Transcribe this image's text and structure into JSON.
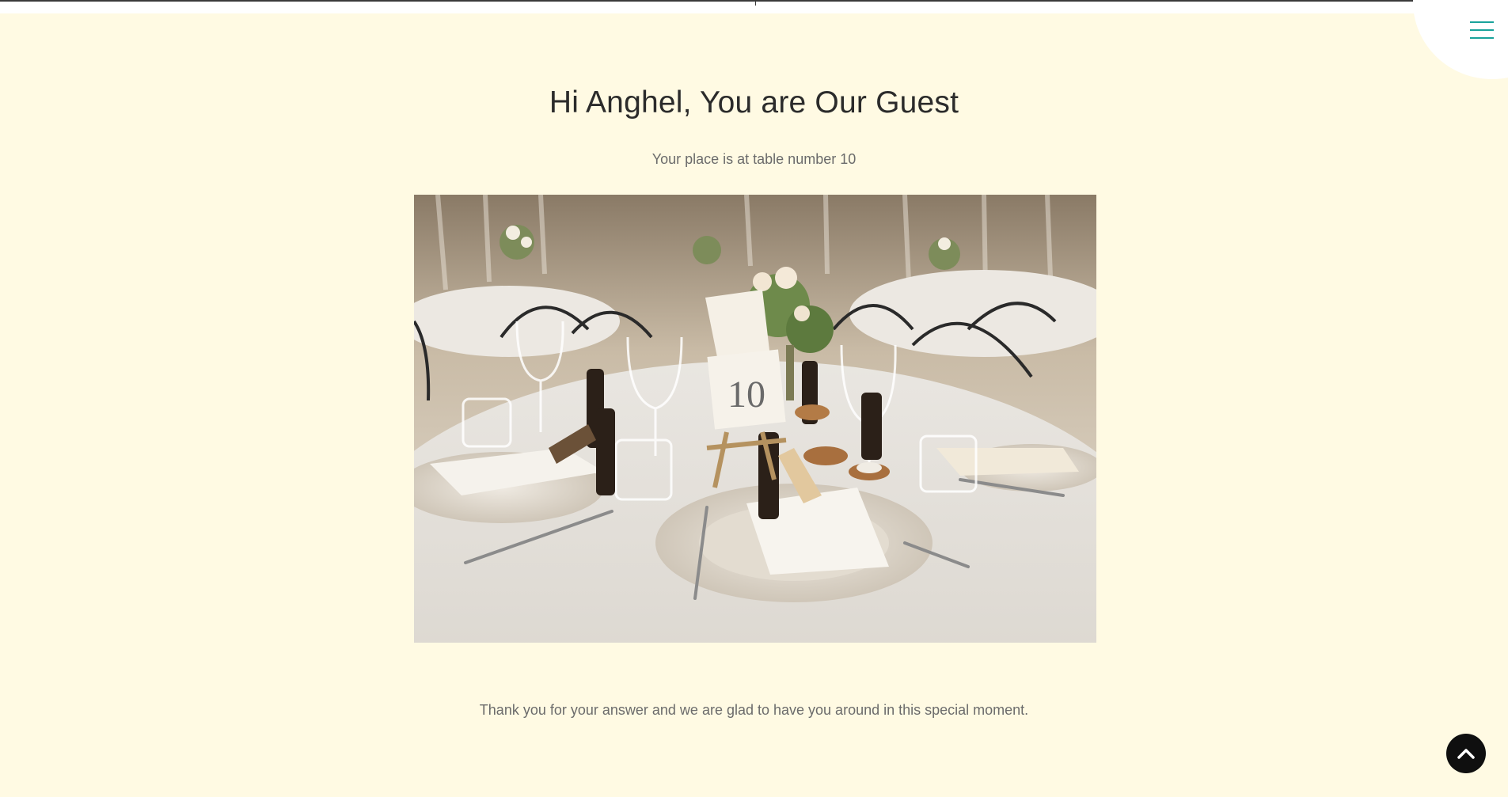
{
  "header": {
    "menu_icon": "hamburger-menu-icon",
    "accent_color": "#1aa39b"
  },
  "main": {
    "title": "Hi Anghel, You are Our Guest",
    "subtitle": "Your place is at table number 10",
    "image": {
      "subject": "table-setting-photo",
      "table_card_text": "10"
    },
    "message": "Thank you for your answer and we are glad to have you around in this special moment."
  },
  "back_to_top": {
    "icon": "chevron-up-icon"
  },
  "colors": {
    "background": "#fffae3",
    "button": "#0f0f0f"
  }
}
